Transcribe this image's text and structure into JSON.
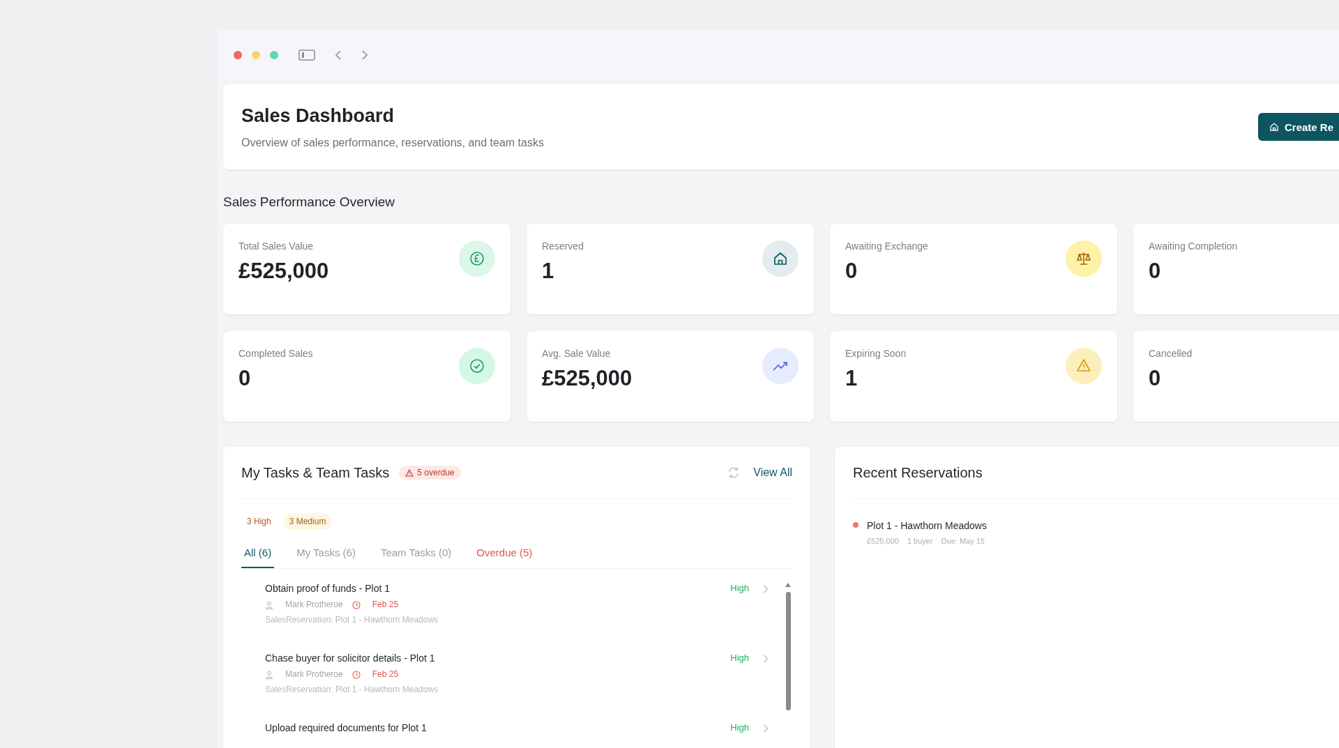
{
  "header": {
    "title": "Sales Dashboard",
    "subtitle": "Overview of sales performance, reservations, and team tasks",
    "button": "Create Re"
  },
  "section_title": "Sales Performance Overview",
  "stats": [
    {
      "label": "Total Sales Value",
      "value": "£525,000",
      "kind": "pound"
    },
    {
      "label": "Reserved",
      "value": "1",
      "kind": "house"
    },
    {
      "label": "Awaiting Exchange",
      "value": "0",
      "kind": "scales"
    },
    {
      "label": "Awaiting Completion",
      "value": "0",
      "kind": "plain"
    },
    {
      "label": "Completed Sales",
      "value": "0",
      "kind": "check"
    },
    {
      "label": "Avg. Sale Value",
      "value": "£525,000",
      "kind": "trend"
    },
    {
      "label": "Expiring Soon",
      "value": "1",
      "kind": "warning"
    },
    {
      "label": "Cancelled",
      "value": "0",
      "kind": "plain"
    }
  ],
  "tasks": {
    "title": "My Tasks & Team Tasks",
    "overdue_badge": "5 overdue",
    "view_all": "View All",
    "chips": [
      {
        "label": "3 High",
        "kind": "high"
      },
      {
        "label": "3 Medium",
        "kind": "medium"
      }
    ],
    "tabs": [
      {
        "label": "All (6)",
        "selected": true,
        "kind": "normal"
      },
      {
        "label": "My Tasks (6)",
        "selected": false,
        "kind": "normal"
      },
      {
        "label": "Team Tasks (0)",
        "selected": false,
        "kind": "normal"
      },
      {
        "label": "Overdue (5)",
        "selected": false,
        "kind": "alert"
      }
    ],
    "items": [
      {
        "title": "Obtain proof of funds - Plot 1",
        "assignee": "Mark Protheroe",
        "due": "Feb 25",
        "reference": "SalesReservation: Plot 1 - Hawthorn Meadows",
        "priority": "High"
      },
      {
        "title": "Chase buyer for solicitor details - Plot 1",
        "assignee": "Mark Protheroe",
        "due": "Feb 25",
        "reference": "SalesReservation: Plot 1 - Hawthorn Meadows",
        "priority": "High"
      },
      {
        "title": "Upload required documents for Plot 1",
        "priority": "High"
      }
    ]
  },
  "reservations": {
    "title": "Recent Reservations",
    "items": [
      {
        "title": "Plot 1 - Hawthorn Meadows",
        "color": "#ef7373",
        "price": "£525,000",
        "buyers": "1 buyer",
        "due": "Due: May 15"
      }
    ]
  }
}
